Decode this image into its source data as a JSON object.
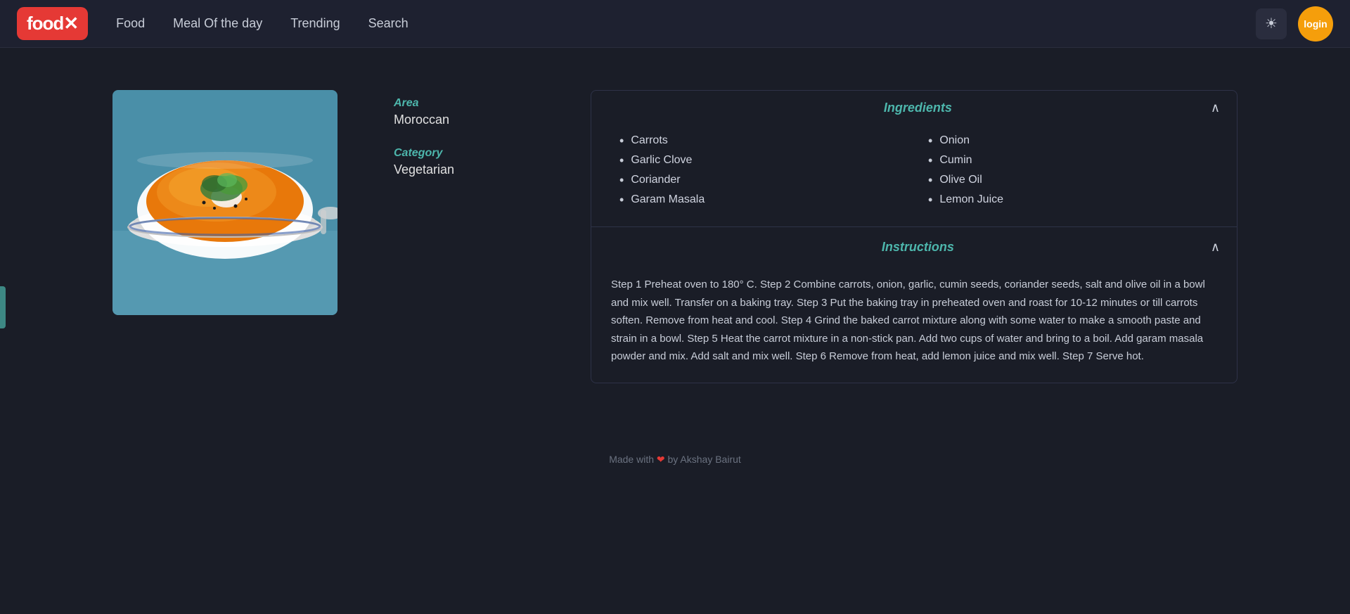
{
  "brand": {
    "name": "food",
    "x": "✕"
  },
  "nav": {
    "links": [
      {
        "label": "Food",
        "id": "food"
      },
      {
        "label": "Meal Of the day",
        "id": "meal-of-day"
      },
      {
        "label": "Trending",
        "id": "trending"
      },
      {
        "label": "Search",
        "id": "search"
      }
    ],
    "login_label": "login",
    "theme_icon": "☀"
  },
  "recipe": {
    "area_label": "Area",
    "area_value": "Moroccan",
    "category_label": "Category",
    "category_value": "Vegetarian",
    "ingredients_title": "Ingredients",
    "left_ingredients": [
      "Carrots",
      "Garlic Clove",
      "Coriander",
      "Garam Masala"
    ],
    "right_ingredients": [
      "Onion",
      "Cumin",
      "Olive Oil",
      "Lemon Juice"
    ],
    "instructions_title": "Instructions",
    "instructions_text": "Step 1 Preheat oven to 180° C. Step 2 Combine carrots, onion, garlic, cumin seeds, coriander seeds, salt and olive oil in a bowl and mix well. Transfer on a baking tray. Step 3 Put the baking tray in preheated oven and roast for 10-12 minutes or till carrots soften. Remove from heat and cool. Step 4 Grind the baked carrot mixture along with some water to make a smooth paste and strain in a bowl. Step 5 Heat the carrot mixture in a non-stick pan. Add two cups of water and bring to a boil. Add garam masala powder and mix. Add salt and mix well. Step 6 Remove from heat, add lemon juice and mix well. Step 7 Serve hot."
  },
  "footer": {
    "text": "Made with ❤ by Akshay Bairut"
  },
  "colors": {
    "accent": "#4db6ac",
    "brand_bg": "#e53935",
    "dark_bg": "#1a1d27",
    "nav_bg": "#1e2130"
  }
}
